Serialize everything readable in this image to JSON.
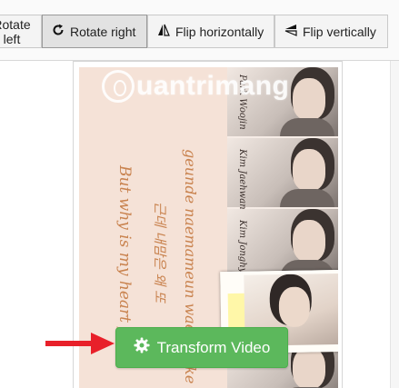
{
  "toolbar": {
    "rotate_left_label": "Rotate left",
    "rotate_right_label": "Rotate right",
    "flip_horizontally_label": "Flip horizontally",
    "flip_vertically_label": "Flip vertically",
    "active_button": "rotate-right"
  },
  "preview": {
    "watermark": "uantrimang",
    "names": [
      "Park Woojin",
      "Kim Jaehwan",
      "Kim Jonghyun"
    ],
    "lyrics": [
      "geunde naemameun wae ireoke ap",
      "근데 내맘은 왜 또",
      "But why is my heart filled"
    ]
  },
  "action": {
    "transform_label": "Transform Video",
    "button_color": "#5cb85c",
    "arrow_color": "#e8202a"
  }
}
